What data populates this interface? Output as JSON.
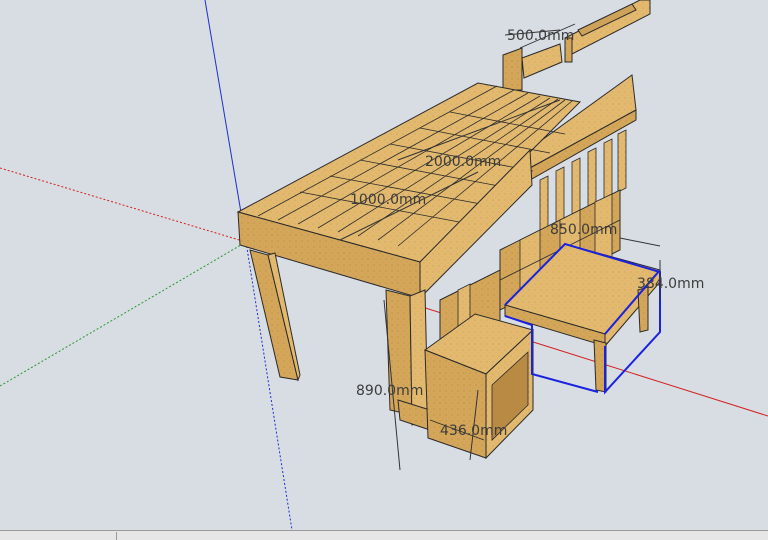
{
  "app": "SketchUp",
  "colors": {
    "sky": "#d7dde3",
    "wood": "#e2b96f",
    "wood_dark": "#c99a4e",
    "wood_side": "#d6a85a",
    "edge": "#2b2b2b",
    "axis_red": "#d42020",
    "axis_green": "#2a9a2a",
    "axis_blue": "#1e2ed0",
    "selection": "#1a22e0"
  },
  "dimensions": {
    "length": "2000.0mm",
    "width": "1000.0mm",
    "height": "890.0mm",
    "step_width": "436.0mm",
    "desk_depth": "850.0mm",
    "desk_height": "384.0mm",
    "shelf_width": "500.0mm"
  }
}
